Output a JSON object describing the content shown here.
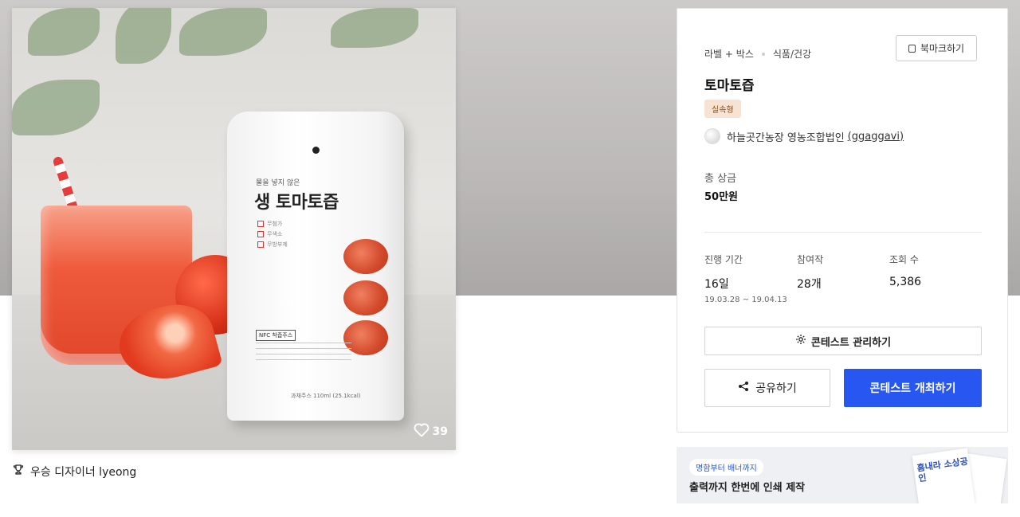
{
  "image": {
    "pouch_subtitle": "물을 넣지 않은",
    "pouch_title": "생 토마토즙",
    "pouch_checks": [
      "무첨가",
      "무색소",
      "무방부제"
    ],
    "pouch_nfc": "NFC 착즙주스",
    "pouch_volume": "과채주스 110ml (25.1kcal)",
    "likes": "39"
  },
  "winner": {
    "label": "우승 디자이너 lyeong"
  },
  "contest": {
    "category": "라벨 + 박스",
    "subcategory": "식품/건강",
    "bookmark_label": "북마크하기",
    "title": "토마토즙",
    "badge": "실속형",
    "host_name": "하늘곳간농장 영농조합법인",
    "host_id": "(ggaggavi)",
    "prize_label": "총 상금",
    "prize_value": "50만원",
    "stats": {
      "period_label": "진행 기간",
      "period_value": "16일",
      "period_range": "19.03.28 ~ 19.04.13",
      "entries_label": "참여작",
      "entries_value": "28개",
      "views_label": "조회 수",
      "views_value": "5,386"
    },
    "manage_label": "콘테스트 관리하기",
    "share_label": "공유하기",
    "host_button_label": "콘테스트 개최하기"
  },
  "banner": {
    "tag": "명함부터 배너까지",
    "text": "출력까지 한번에 인쇄 제작",
    "flyer_text": "흠내라 소상공인"
  },
  "colors": {
    "primary": "#2856f0",
    "badge_bg": "#f6e3d1",
    "badge_text": "#8a4b19"
  },
  "icons": [
    "heart-icon",
    "trophy-icon",
    "bookmark-icon",
    "gear-icon",
    "share-icon"
  ]
}
